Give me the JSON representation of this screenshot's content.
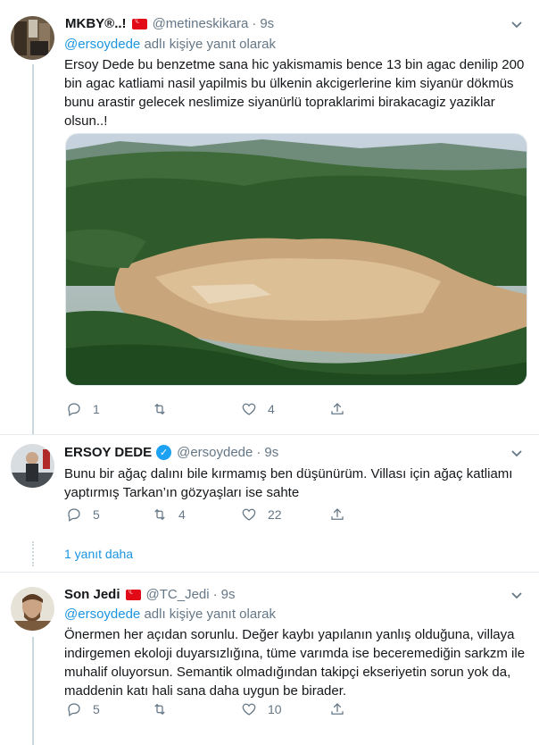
{
  "tweets": [
    {
      "display_name": "MKBY®..!",
      "handle": "@metineskikara",
      "dot": "·",
      "time": "9s",
      "reply_prefix": "@ersoydede",
      "reply_suffix": " adlı kişiye yanıt olarak",
      "text": "Ersoy Dede bu benzetme sana hic yakismamis bence 13 bin agac denilip 200 bin agac katliami nasil yapilmis bu ülkenin akcigerlerine kim siyanür dökmüs bunu arastir gelecek neslimize siyanürlü topraklarimi birakacagiz yaziklar olsun..!",
      "reply_count": "1",
      "retweet_count": "",
      "like_count": "4"
    },
    {
      "display_name": "ERSOY DEDE",
      "handle": "@ersoydede",
      "dot": "·",
      "time": "9s",
      "text": "Bunu bir ağaç dalını bile kırmamış ben düşünürüm. Villası için ağaç katliamı yaptırmış Tarkan’ın gözyaşları ise sahte",
      "reply_count": "5",
      "retweet_count": "4",
      "like_count": "22"
    },
    {
      "display_name": "Son Jedi",
      "handle": "@TC_Jedi",
      "dot": "·",
      "time": "9s",
      "reply_prefix": "@ersoydede",
      "reply_suffix": " adlı kişiye yanıt olarak",
      "text": "Önermen her açıdan sorunlu. Değer kaybı yapılanın yanlış olduğuna, villaya indirgemen ekoloji duyarsızlığına, tüme varımda ise beceremediğin sarkzm ile muhalif oluyorsun. Semantik olmadığından takipçi ekseriyetin sorun yok da, maddenin katı hali sana daha uygun be birader.",
      "reply_count": "5",
      "retweet_count": "",
      "like_count": "10"
    }
  ],
  "more_replies": "1 yanıt daha",
  "icons": {
    "reply": "reply-icon",
    "retweet": "retweet-icon",
    "like": "heart-icon",
    "share": "share-icon",
    "menu": "chevron-down-icon",
    "verified": "verified-badge-icon",
    "flag": "turkey-flag-icon"
  },
  "colors": {
    "link": "#1b95e0",
    "muted": "#657786",
    "verified": "#1da1f2",
    "flag": "#e30a17"
  }
}
